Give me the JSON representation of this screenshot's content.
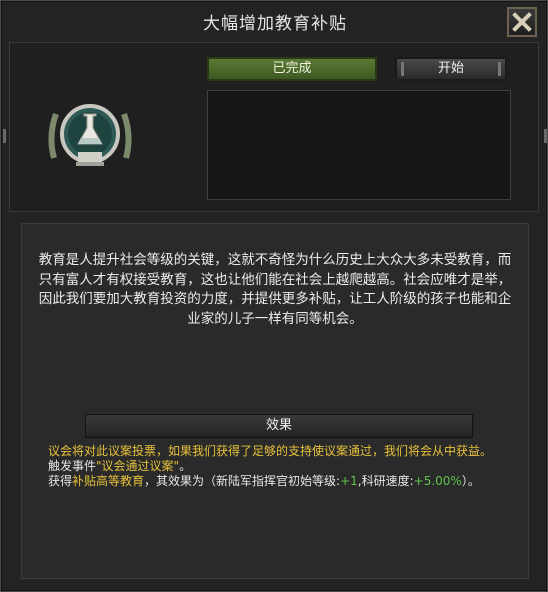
{
  "window": {
    "title": "大幅增加教育补贴"
  },
  "buttons": {
    "status_label": "已完成",
    "start_label": "开始",
    "effects_label": "效果"
  },
  "description": "教育是人提升社会等级的关键，这就不奇怪为什么历史上大众大多未受教育，而只有富人才有权接受教育，这也让他们能在社会上越爬越高。社会应唯才是举，因此我们要加大教育投资的力度，并提供更多补贴，让工人阶级的孩子也能和企业家的儿子一样有同等机会。",
  "effects": {
    "line1": "议会将对此议案投票，如果我们获得了足够的支持使议案通过，我们将会从中获益。",
    "line2_prefix": "触发事件",
    "line2_event": "\"议会通过议案\"",
    "line2_suffix": "。",
    "line3_a": "获得",
    "line3_bonus": "补贴高等教育",
    "line3_b": "，其效果为（新陆军指挥官初始等级:",
    "line3_val1": "+1",
    "line3_c": ",科研速度:",
    "line3_val2": "+5.00%",
    "line3_d": "）。"
  },
  "icons": {
    "close": "close-icon",
    "emblem": "education-flask-emblem-icon"
  },
  "colors": {
    "status_green": "#4e6e2c",
    "effect_yellow": "#e6c23a",
    "bonus_green": "#5fc24a"
  }
}
